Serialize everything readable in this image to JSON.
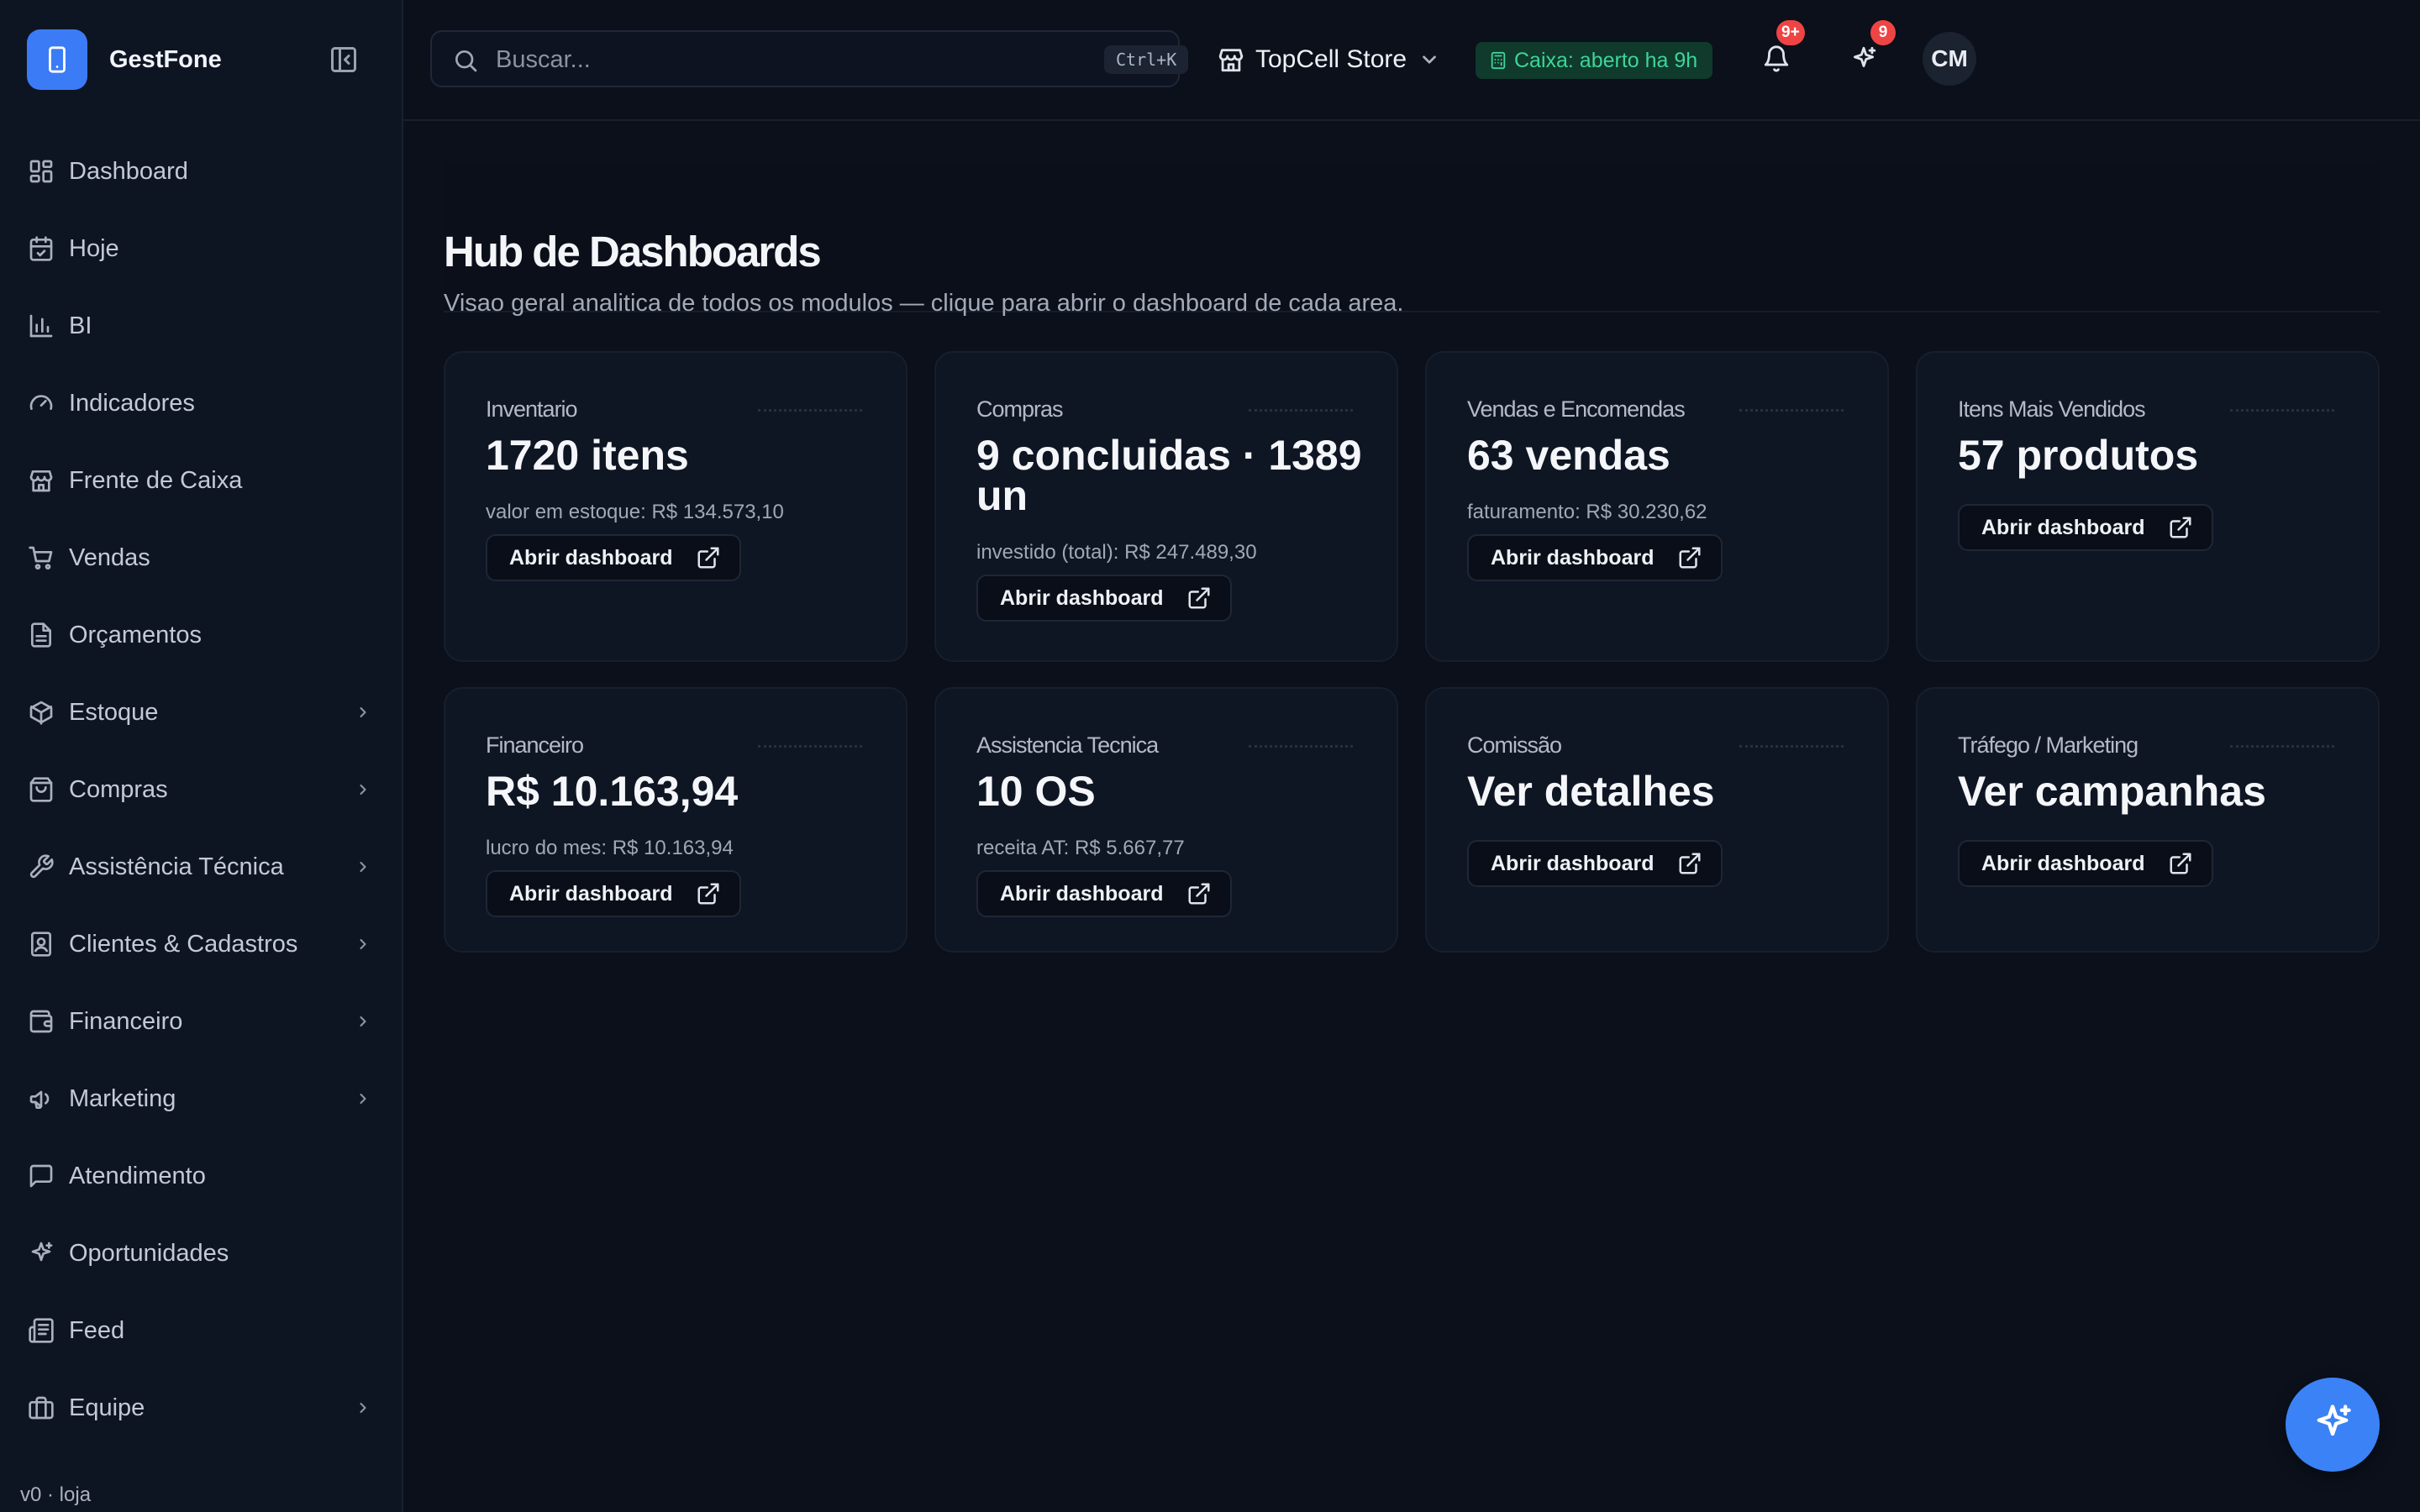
{
  "app": {
    "name": "GestFone",
    "version": "v0 · loja"
  },
  "sidebar": {
    "items": [
      {
        "label": "Dashboard",
        "icon": "grid-icon"
      },
      {
        "label": "Hoje",
        "icon": "calendar-icon"
      },
      {
        "label": "BI",
        "icon": "bar-chart-icon"
      },
      {
        "label": "Indicadores",
        "icon": "gauge-icon"
      },
      {
        "label": "Frente de Caixa",
        "icon": "store-icon"
      },
      {
        "label": "Vendas",
        "icon": "cart-icon"
      },
      {
        "label": "Orçamentos",
        "icon": "document-icon"
      },
      {
        "label": "Estoque",
        "icon": "package-icon"
      },
      {
        "label": "Compras",
        "icon": "shopping-bag-icon"
      },
      {
        "label": "Assistência Técnica",
        "icon": "wrench-icon"
      },
      {
        "label": "Clientes & Cadastros",
        "icon": "contact-icon"
      },
      {
        "label": "Financeiro",
        "icon": "wallet-icon"
      },
      {
        "label": "Marketing",
        "icon": "megaphone-icon"
      },
      {
        "label": "Atendimento",
        "icon": "message-icon"
      },
      {
        "label": "Oportunidades",
        "icon": "sparkles-icon"
      },
      {
        "label": "Feed",
        "icon": "newspaper-icon"
      },
      {
        "label": "Equipe",
        "icon": "briefcase-icon"
      }
    ]
  },
  "header": {
    "search_placeholder": "Buscar...",
    "search_shortcut": "Ctrl+K",
    "store_name": "TopCell Store",
    "caixa_status": "Caixa: aberto ha 9h",
    "notifications_badge": "9+",
    "opportunities_badge": "9",
    "avatar_initials": "CM"
  },
  "page": {
    "title": "Hub de Dashboards",
    "subtitle": "Visao geral analitica de todos os modulos — clique para abrir o dashboard de cada area."
  },
  "cards": [
    {
      "label": "Inventario",
      "value": "1720 itens",
      "sub": "valor em estoque: R$ 134.573,10",
      "button": "Abrir dashboard"
    },
    {
      "label": "Compras",
      "value": "9 concluidas · 1389 un",
      "sub": "investido (total): R$ 247.489,30",
      "button": "Abrir dashboard"
    },
    {
      "label": "Vendas e Encomendas",
      "value": "63 vendas",
      "sub": "faturamento: R$ 30.230,62",
      "button": "Abrir dashboard"
    },
    {
      "label": "Itens Mais Vendidos",
      "value": "57 produtos",
      "sub": "",
      "button": "Abrir dashboard"
    },
    {
      "label": "Financeiro",
      "value": "R$ 10.163,94",
      "sub": "lucro do mes: R$ 10.163,94",
      "button": "Abrir dashboard"
    },
    {
      "label": "Assistencia Tecnica",
      "value": "10 OS",
      "sub": "receita AT: R$ 5.667,77",
      "button": "Abrir dashboard"
    },
    {
      "label": "Comissão",
      "value": "Ver detalhes",
      "sub": "",
      "button": "Abrir dashboard"
    },
    {
      "label": "Tráfego / Marketing",
      "value": "Ver campanhas",
      "sub": "",
      "button": "Abrir dashboard"
    }
  ],
  "colors": {
    "accent": "#3b82f6",
    "caixa_bg": "#0f3a2c",
    "caixa_text": "#3fd49a",
    "badge": "#ef4444"
  }
}
